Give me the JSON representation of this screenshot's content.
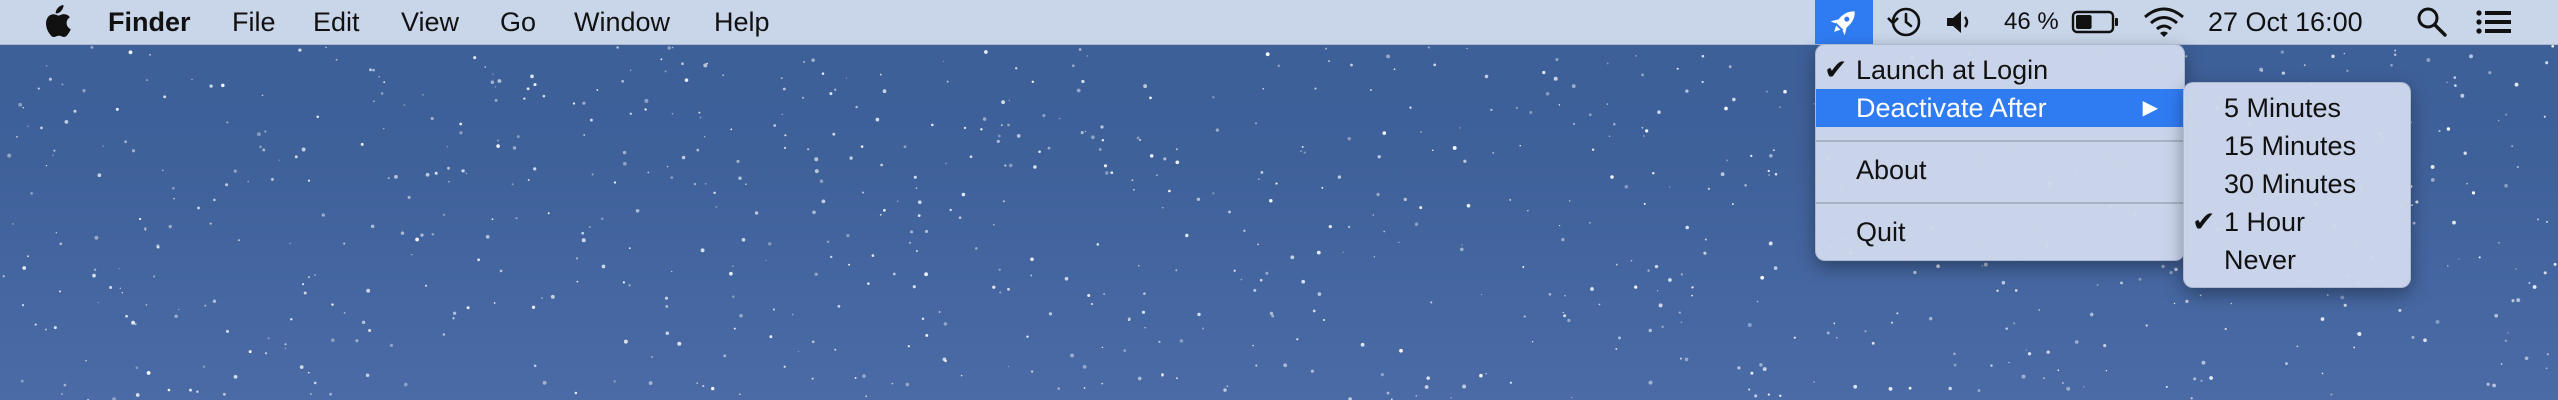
{
  "menubar": {
    "app_name": "Finder",
    "menus": [
      "File",
      "Edit",
      "View",
      "Go",
      "Window",
      "Help"
    ],
    "status": {
      "battery_percent": "46 %",
      "battery_level": 0.46,
      "datetime": "27 Oct  16:00"
    },
    "icons": [
      "apple-icon",
      "rocket-icon",
      "time-machine-icon",
      "volume-icon",
      "battery-icon",
      "wifi-icon",
      "spotlight-search-icon",
      "notification-center-icon"
    ]
  },
  "dropdown": {
    "items": [
      {
        "label": "Launch at Login",
        "checked": true
      },
      {
        "label": "Deactivate After",
        "submenu": true,
        "highlighted": true
      },
      {
        "label": "About"
      },
      {
        "label": "Quit"
      }
    ],
    "submenu_arrow": "▶"
  },
  "submenu": {
    "items": [
      {
        "label": "5 Minutes"
      },
      {
        "label": "15 Minutes"
      },
      {
        "label": "30 Minutes"
      },
      {
        "label": "1 Hour",
        "checked": true
      },
      {
        "label": "Never"
      }
    ]
  },
  "check_glyph": "✔",
  "colors": {
    "menubar": "#c9d6ea",
    "highlight": "#2f7cf2",
    "desktop": "#3f619a"
  }
}
